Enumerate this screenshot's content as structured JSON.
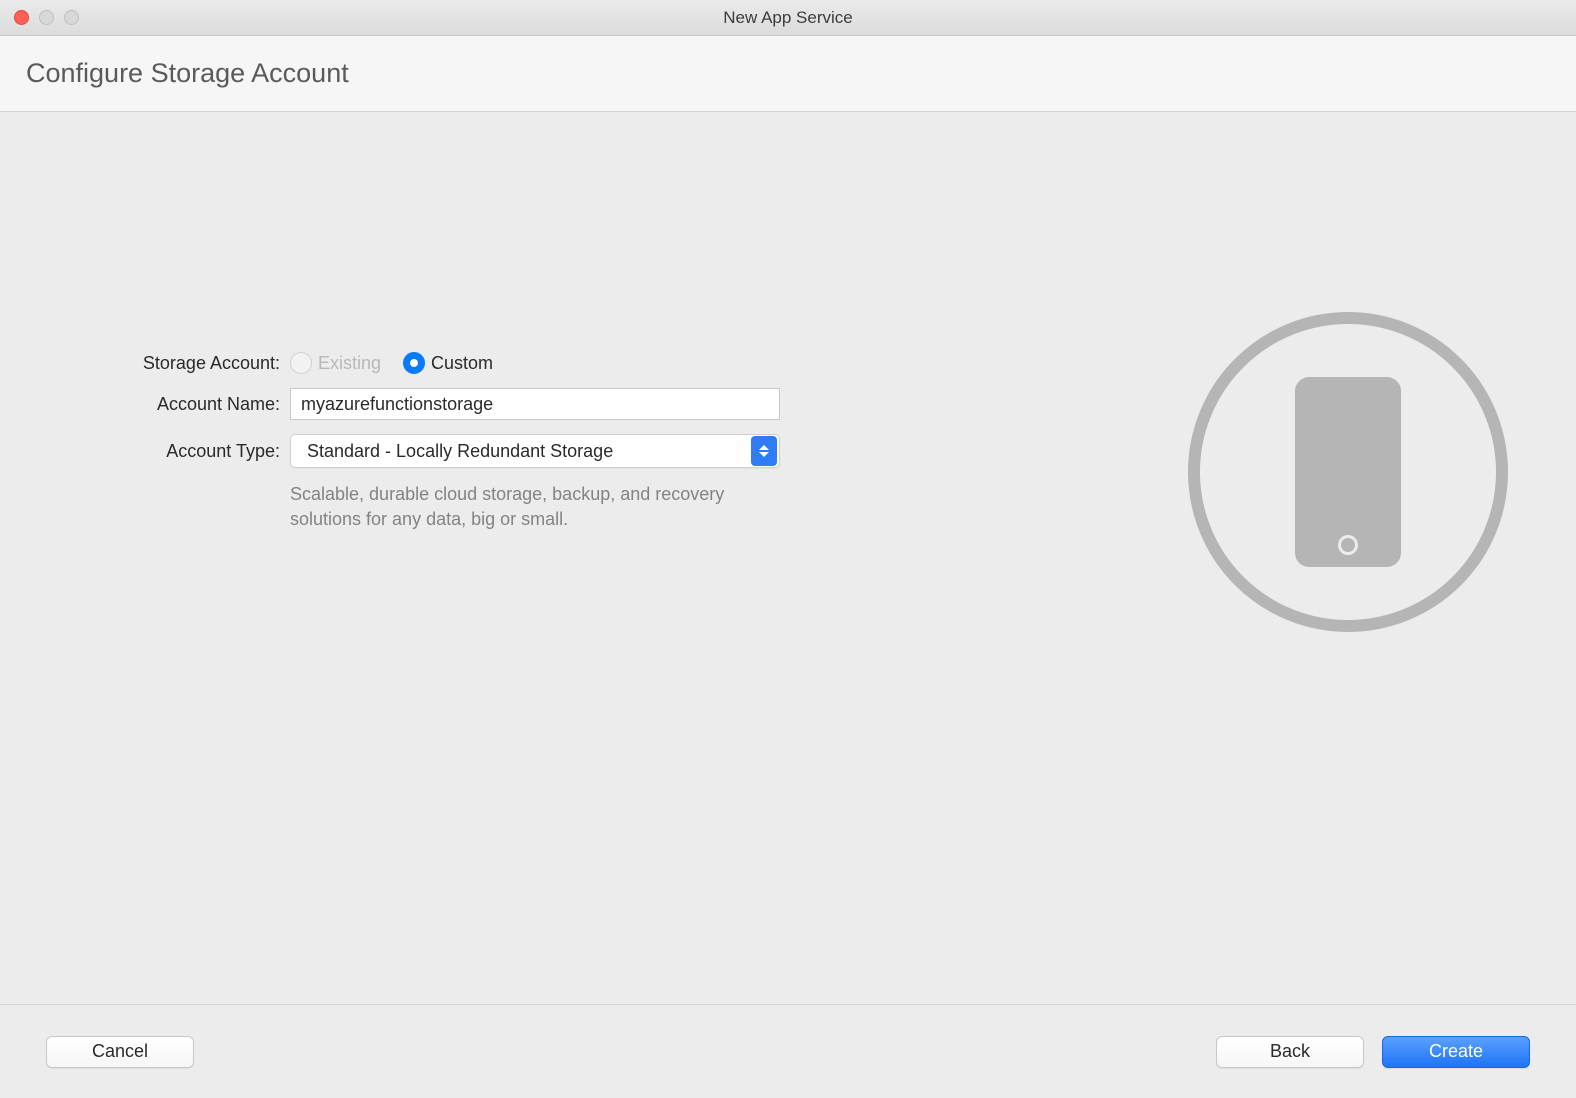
{
  "window": {
    "title": "New App Service"
  },
  "page": {
    "heading": "Configure Storage Account"
  },
  "form": {
    "storage_account_label": "Storage Account:",
    "storage_account_options": {
      "existing": "Existing",
      "custom": "Custom",
      "selected": "custom",
      "existing_enabled": false
    },
    "account_name_label": "Account Name:",
    "account_name_value": "myazurefunctionstorage",
    "account_type_label": "Account Type:",
    "account_type_value": "Standard - Locally Redundant Storage",
    "description": "Scalable, durable cloud storage, backup, and recovery solutions for any data, big or small."
  },
  "buttons": {
    "cancel": "Cancel",
    "back": "Back",
    "create": "Create"
  },
  "icons": {
    "illustration": "mobile-phone-in-circle"
  }
}
